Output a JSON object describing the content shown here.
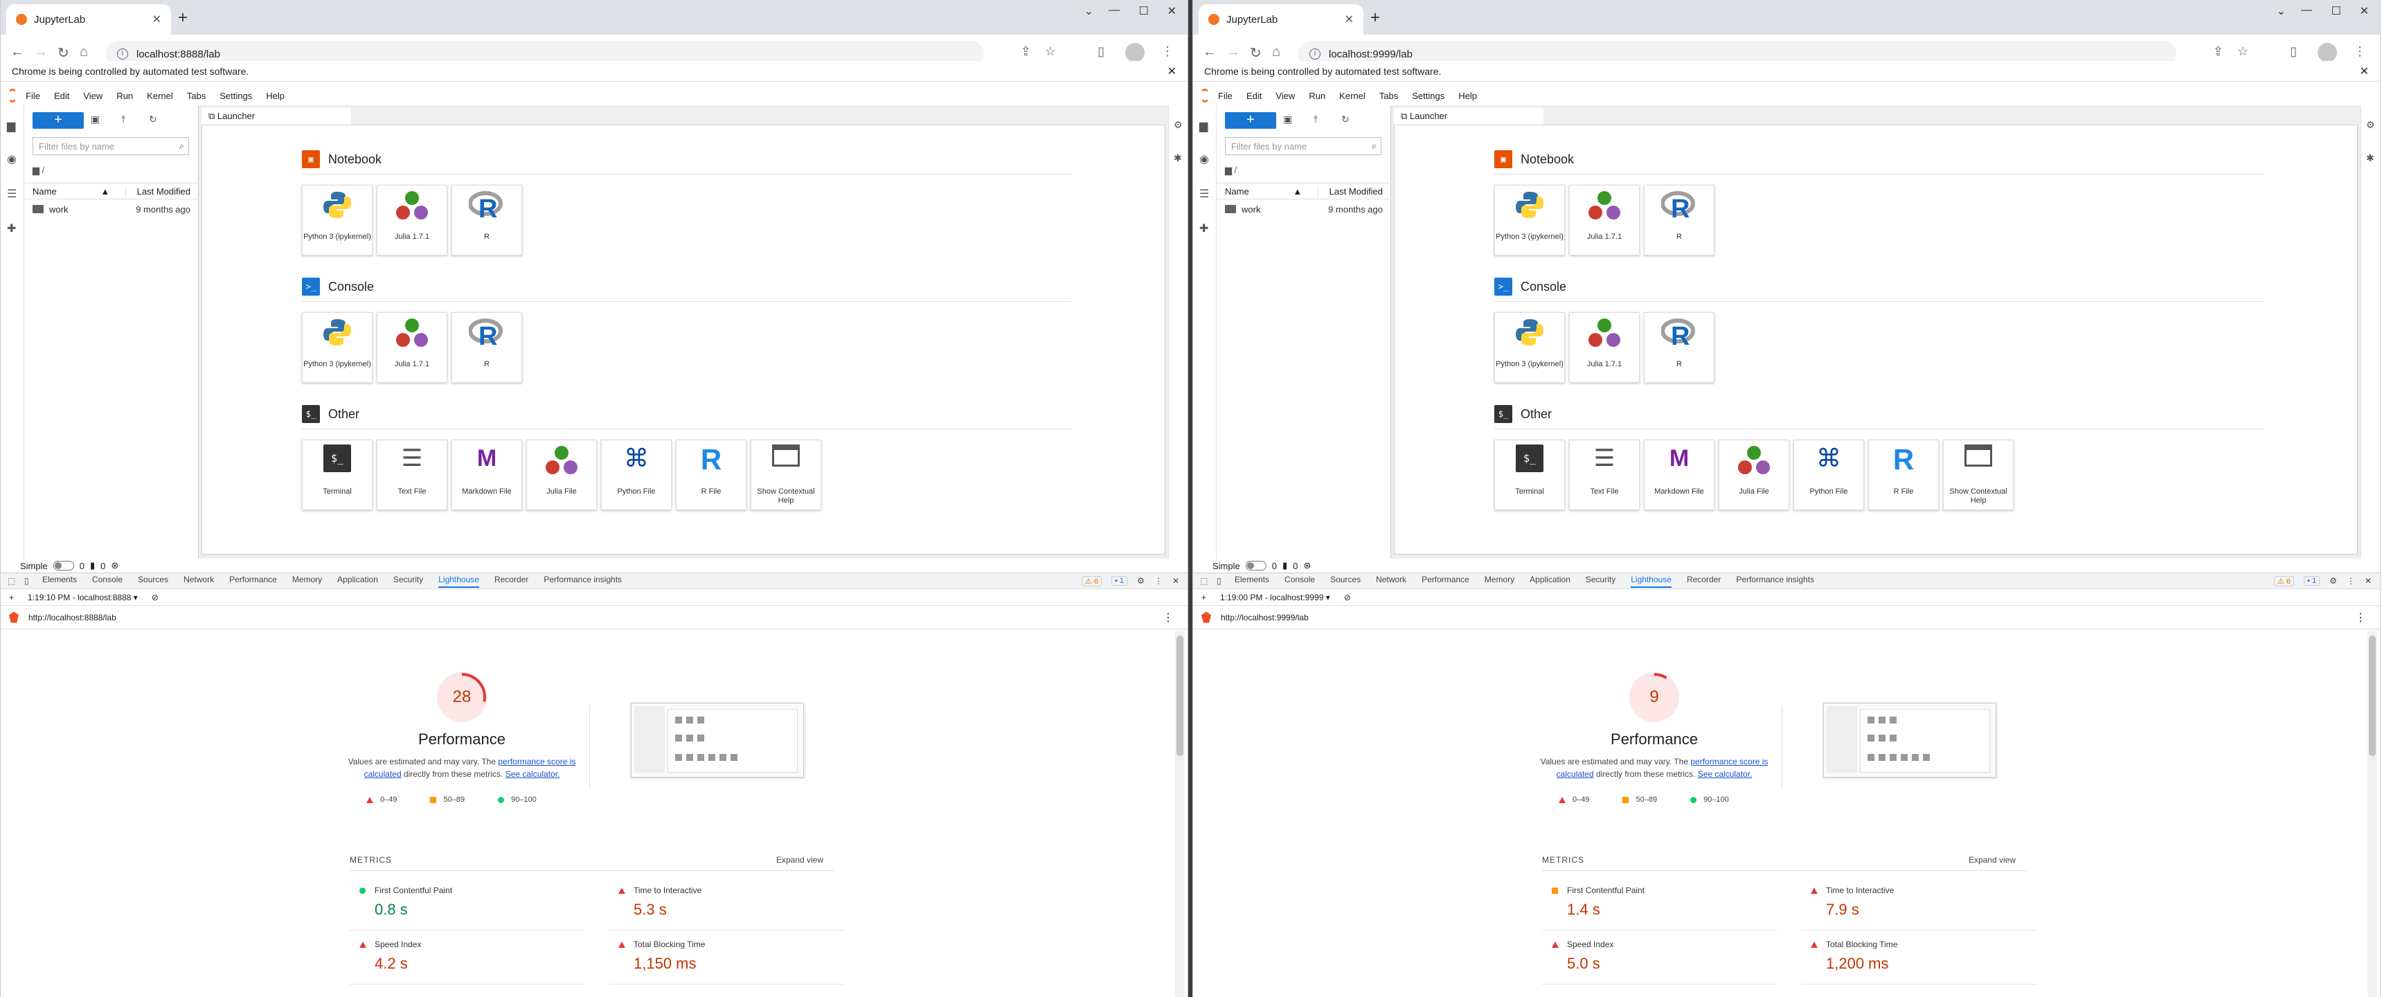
{
  "windows": [
    {
      "tab_title": "JupyterLab",
      "url": "localhost:8888/lab",
      "infobar": "Chrome is being controlled by automated test software.",
      "menu": [
        "File",
        "Edit",
        "View",
        "Run",
        "Kernel",
        "Tabs",
        "Settings",
        "Help"
      ],
      "filter_placeholder": "Filter files by name",
      "breadcrumb": "/",
      "col_name": "Name",
      "col_modified": "Last Modified",
      "files": [
        {
          "name": "work",
          "modified": "9 months ago"
        }
      ],
      "doc_tab": "Launcher",
      "sections": {
        "notebook": "Notebook",
        "console": "Console",
        "other": "Other"
      },
      "notebook_cards": [
        "Python 3 (ipykernel)",
        "Julia 1.7.1",
        "R"
      ],
      "console_cards": [
        "Python 3 (ipykernel)",
        "Julia 1.7.1",
        "R"
      ],
      "other_cards": [
        "Terminal",
        "Text File",
        "Markdown File",
        "Julia File",
        "Python File",
        "R File",
        "Show Contextual Help"
      ],
      "status": {
        "mode": "Simple",
        "a": "0",
        "b": "0"
      },
      "devtools_tabs": [
        "Elements",
        "Console",
        "Sources",
        "Network",
        "Performance",
        "Memory",
        "Application",
        "Security",
        "Lighthouse",
        "Recorder",
        "Performance insights"
      ],
      "devtools_active": "Lighthouse",
      "warn_count": "6",
      "msg_count": "1",
      "report_time": "1:19:10 PM - localhost:8888",
      "report_url": "http://localhost:8888/lab",
      "score": "28",
      "score_fraction": 0.28,
      "perf_title": "Performance",
      "perf_desc_a": "Values are estimated and may vary. The ",
      "perf_desc_link": "performance score is calculated",
      "perf_desc_b": " directly from these metrics. ",
      "perf_desc_link2": "See calculator.",
      "legend": [
        "0–49",
        "50–89",
        "90–100"
      ],
      "metrics_label": "METRICS",
      "expand": "Expand view",
      "metrics": [
        {
          "name": "First Contentful Paint",
          "value": "0.8 s",
          "rating": "good"
        },
        {
          "name": "Time to Interactive",
          "value": "5.3 s",
          "rating": "poor"
        },
        {
          "name": "Speed Index",
          "value": "4.2 s",
          "rating": "poor"
        },
        {
          "name": "Total Blocking Time",
          "value": "1,150 ms",
          "rating": "poor"
        }
      ]
    },
    {
      "tab_title": "JupyterLab",
      "url": "localhost:9999/lab",
      "infobar": "Chrome is being controlled by automated test software.",
      "menu": [
        "File",
        "Edit",
        "View",
        "Run",
        "Kernel",
        "Tabs",
        "Settings",
        "Help"
      ],
      "filter_placeholder": "Filter files by name",
      "breadcrumb": "/",
      "col_name": "Name",
      "col_modified": "Last Modified",
      "files": [
        {
          "name": "work",
          "modified": "9 months ago"
        }
      ],
      "doc_tab": "Launcher",
      "sections": {
        "notebook": "Notebook",
        "console": "Console",
        "other": "Other"
      },
      "notebook_cards": [
        "Python 3 (ipykernel)",
        "Julia 1.7.1",
        "R"
      ],
      "console_cards": [
        "Python 3 (ipykernel)",
        "Julia 1.7.1",
        "R"
      ],
      "other_cards": [
        "Terminal",
        "Text File",
        "Markdown File",
        "Julia File",
        "Python File",
        "R File",
        "Show Contextual Help"
      ],
      "status": {
        "mode": "Simple",
        "a": "0",
        "b": "0"
      },
      "devtools_tabs": [
        "Elements",
        "Console",
        "Sources",
        "Network",
        "Performance",
        "Memory",
        "Application",
        "Security",
        "Lighthouse",
        "Recorder",
        "Performance insights"
      ],
      "devtools_active": "Lighthouse",
      "warn_count": "6",
      "msg_count": "1",
      "report_time": "1:19:00 PM - localhost:9999",
      "report_url": "http://localhost:9999/lab",
      "score": "9",
      "score_fraction": 0.09,
      "perf_title": "Performance",
      "perf_desc_a": "Values are estimated and may vary. The ",
      "perf_desc_link": "performance score is calculated",
      "perf_desc_b": " directly from these metrics. ",
      "perf_desc_link2": "See calculator.",
      "legend": [
        "0–49",
        "50–89",
        "90–100"
      ],
      "metrics_label": "METRICS",
      "expand": "Expand view",
      "metrics": [
        {
          "name": "First Contentful Paint",
          "value": "1.4 s",
          "rating": "average"
        },
        {
          "name": "Time to Interactive",
          "value": "7.9 s",
          "rating": "poor"
        },
        {
          "name": "Speed Index",
          "value": "5.0 s",
          "rating": "poor"
        },
        {
          "name": "Total Blocking Time",
          "value": "1,200 ms",
          "rating": "poor"
        }
      ]
    }
  ],
  "colors": {
    "jupyter_orange": "#f37726",
    "accent_blue": "#1976d2",
    "poor": "#c33300",
    "good": "#018642",
    "average": "#ff9800"
  }
}
